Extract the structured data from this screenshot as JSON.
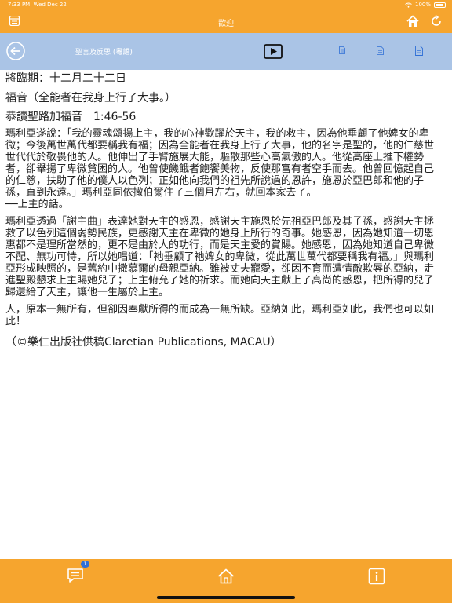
{
  "status_bar": {
    "time": "7:33 PM",
    "date": "Wed Dec 22",
    "battery": "100%"
  },
  "title_bar": {
    "title": "歡迎"
  },
  "toolbar": {
    "label": "聖言及反思 (粵語)"
  },
  "content": {
    "date": "將臨期：十二月二十二日",
    "verse": "福音（全能者在我身上行了大事。）",
    "reading": "恭讀聖路加福音　1:46-56",
    "para1": "瑪利亞遂說：「我的靈魂頌揚上主，我的心神歡躍於天主，我的救主，因為他垂顧了他婢女的卑微；今後萬世萬代都要稱我有福；因為全能者在我身上行了大事，他的名字是聖的，他的仁慈世世代代於敬畏他的人。他伸出了手臂施展大能，驅散那些心高氣傲的人。他從高座上推下權勢者，卻舉揚了卑微貧困的人。他曾使饑餓者飽饗美物，反使那富有者空手而去。他曾回憶起自己的仁慈，扶助了他的僕人以色列；正如他向我們的祖先所說過的恩許，施恩於亞巴郎和他的子孫，直到永遠。」瑪利亞同依撒伯爾住了三個月左右，就回本家去了。",
    "para1_end": "──上主的話。",
    "para2": "瑪利亞透過「謝主曲」表達她對天主的感恩，感謝天主施恩於先祖亞巴郎及其子孫，感謝天主拯救了以色列這個弱勢民族，更感謝天主在卑微的她身上所行的奇事。她感恩，因為她知道一切恩惠都不是理所當然的，更不是由於人的功行，而是天主愛的賞賜。她感恩，因為她知道自己卑微不配、無功可恃，所以她唱道：「祂垂顧了祂婢女的卑微，從此萬世萬代都要稱我有福。」與瑪利亞形成映照的，是舊約中撒慕爾的母親亞納。雖被丈夫寵愛，卻因不育而遭情敵欺辱的亞納，走進聖殿懇求上主賜她兒子；上主俯允了她的祈求。而她向天主獻上了高尚的感恩，把所得的兒子歸還給了天主，讓他一生屬於上主。",
    "para3": "人，原本一無所有，但卻因奉獻所得的而成為一無所缺。亞納如此，瑪利亞如此，我們也可以如此！",
    "copyright": "（©樂仁出版社供稿Claretian Publications, MACAU）"
  },
  "bottom_bar": {
    "badge": "1"
  },
  "icons": {
    "menu": "menu-icon",
    "home": "home-icon",
    "refresh": "refresh-icon",
    "back": "back-arrow-icon",
    "play": "play-icon",
    "message": "message-icon",
    "info": "info-icon"
  },
  "colors": {
    "accent": "#f6a52e",
    "toolbar": "#aac4e6",
    "badge": "#2f6fd6"
  }
}
